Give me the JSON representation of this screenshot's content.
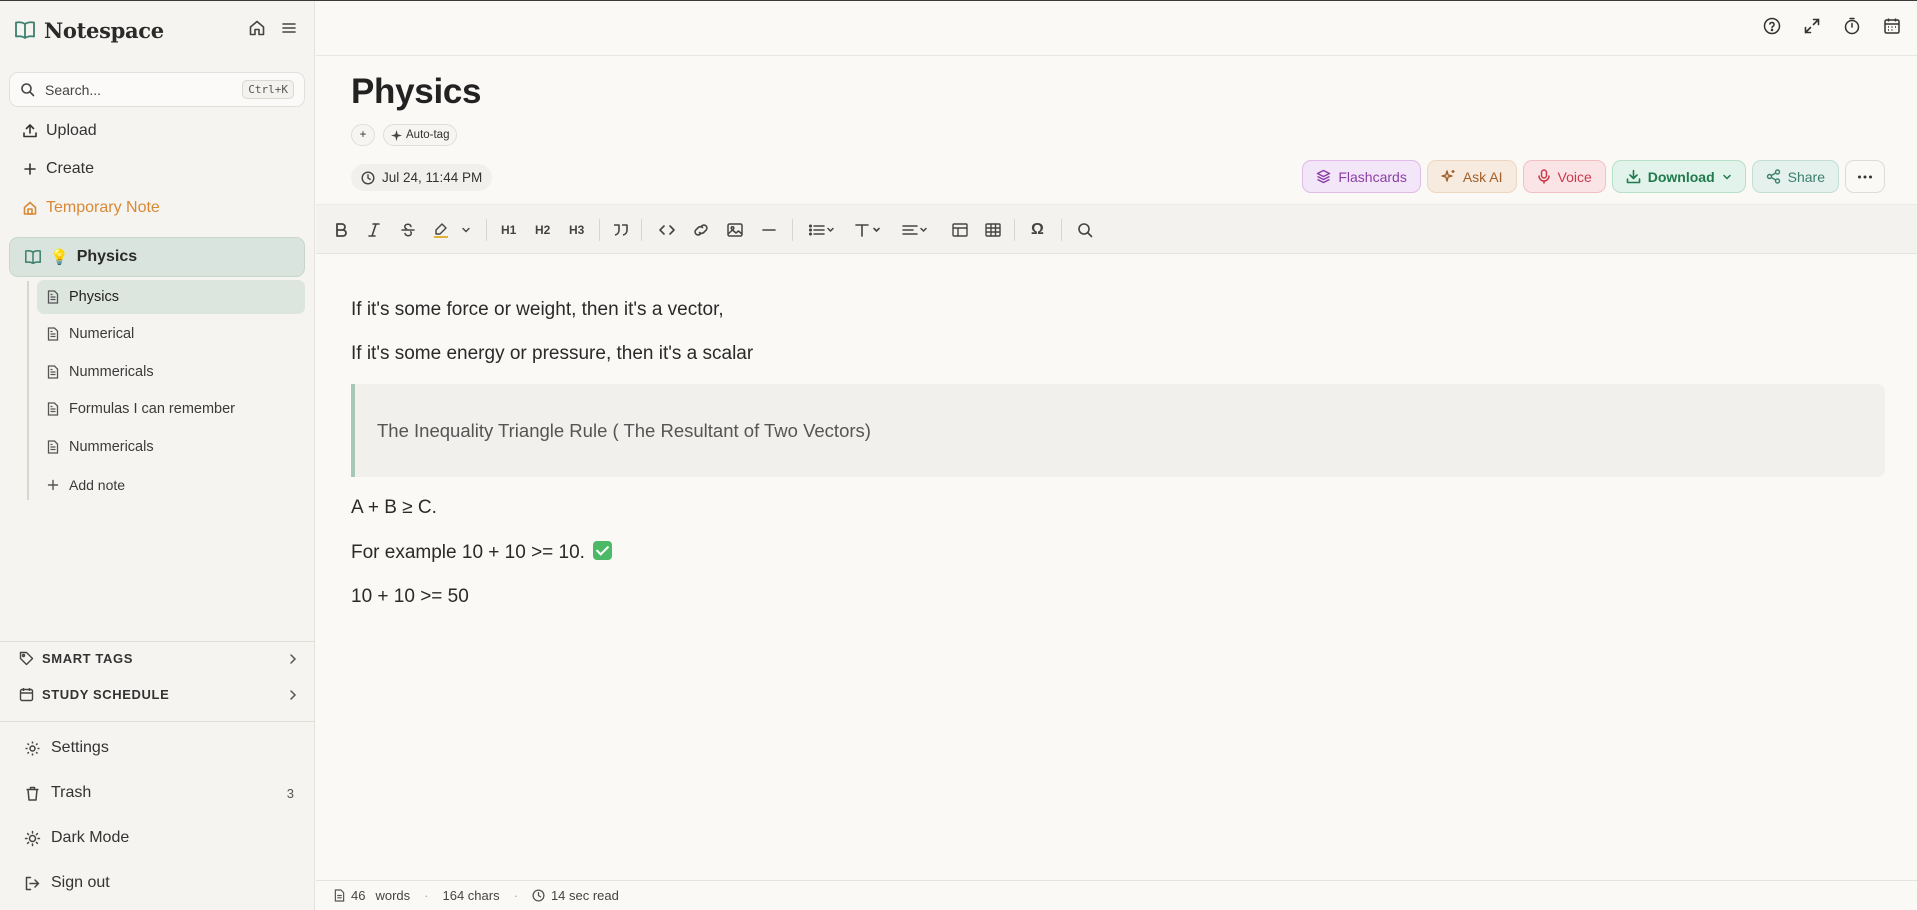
{
  "app": {
    "name": "Notespace"
  },
  "sidebar": {
    "search": {
      "placeholder": "Search...",
      "shortcut": "Ctrl+K"
    },
    "upload_label": "Upload",
    "create_label": "Create",
    "temp_note_label": "Temporary Note",
    "notebook": {
      "emoji": "💡",
      "label": "Physics"
    },
    "notes": [
      {
        "label": "Physics",
        "active": true
      },
      {
        "label": "Numerical"
      },
      {
        "label": "Nummericals"
      },
      {
        "label": "Formulas I can remember"
      },
      {
        "label": "Nummericals"
      }
    ],
    "add_note_label": "Add note",
    "sections": {
      "smart_tags": "SMART TAGS",
      "study_schedule": "STUDY SCHEDULE"
    },
    "bottom": {
      "settings": "Settings",
      "trash": "Trash",
      "trash_count": "3",
      "dark_mode": "Dark Mode",
      "sign_out": "Sign out"
    }
  },
  "note": {
    "title": "Physics",
    "add_tag_symbol": "+",
    "auto_tag_label": "Auto-tag",
    "date": "Jul 24, 11:44 PM",
    "actions": {
      "flashcards": "Flashcards",
      "ask_ai": "Ask AI",
      "voice": "Voice",
      "download": "Download",
      "share": "Share"
    },
    "toolbar": {
      "h1": "H1",
      "h2": "H2",
      "h3": "H3",
      "special": "Ω"
    },
    "content": {
      "line1": "If it's some force or weight, then it's a vector,",
      "line2": "If it's some energy or pressure, then it's a scalar",
      "quote": "The Inequality Triangle Rule ( The Resultant of Two Vectors)",
      "line3": "A + B ≥ C.",
      "line4": "For example 10 + 10 >= 10.",
      "line5": "10 + 10 >= 50"
    },
    "stats": {
      "words_count": "46",
      "words_label": "words",
      "chars": "164 chars",
      "read": "14 sec read"
    }
  },
  "colors": {
    "accent_green": "#1f7a4d",
    "temp_note": "#d98935",
    "flashcards": "#8b3fa6",
    "voice": "#c93a4a"
  }
}
